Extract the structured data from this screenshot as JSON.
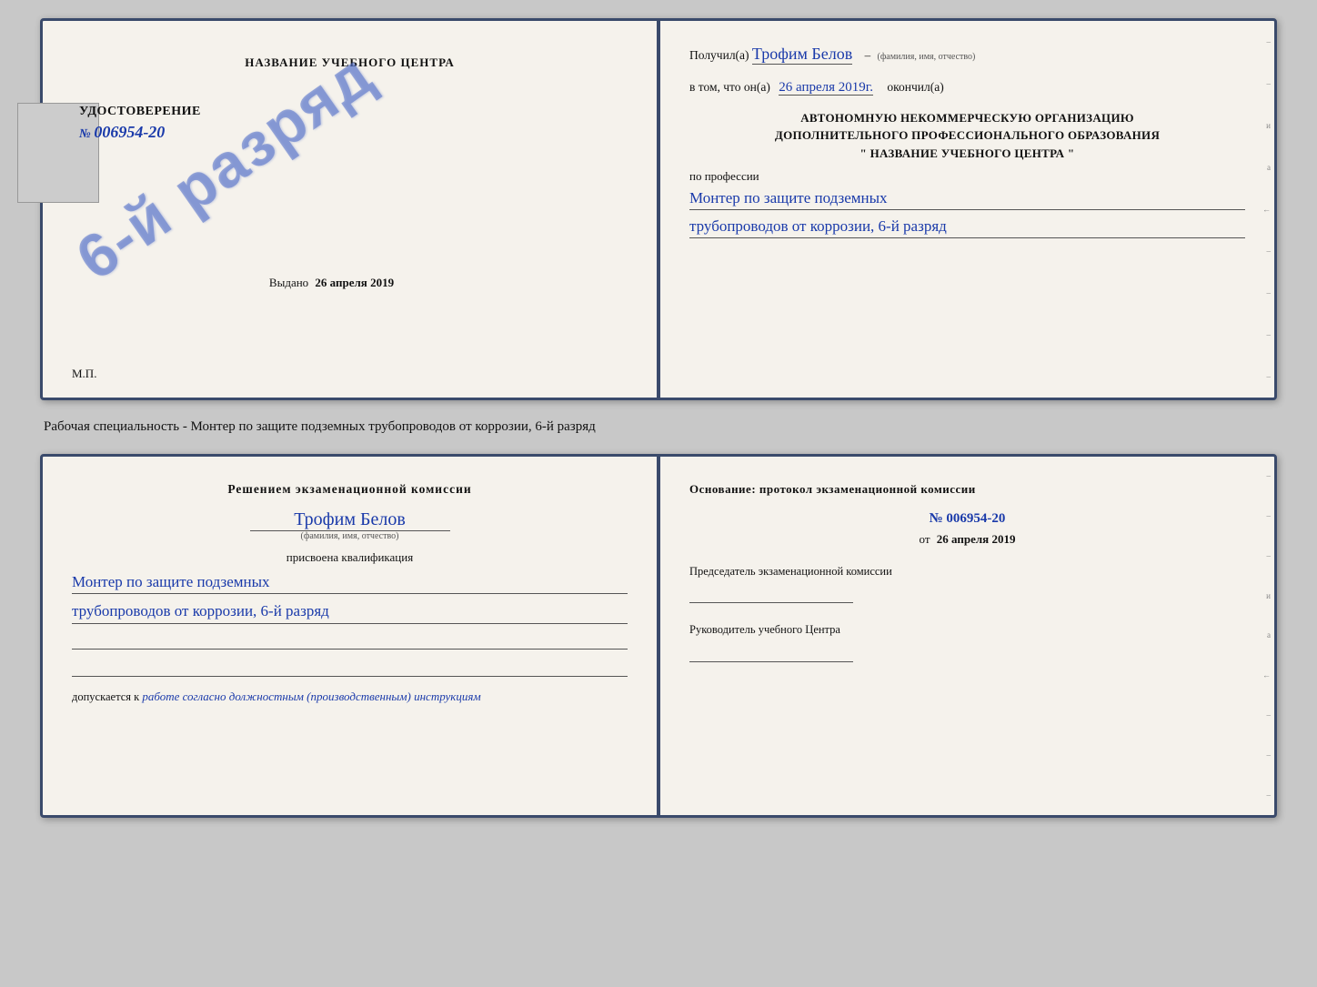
{
  "doc1": {
    "left": {
      "center_title": "НАЗВАНИЕ УЧЕБНОГО ЦЕНТРА",
      "cert_label": "УДОСТОВЕРЕНИЕ",
      "cert_number_prefix": "№",
      "cert_number": "006954-20",
      "issued_prefix": "Выдано",
      "issued_date": "26 апреля 2019",
      "mp_label": "М.П.",
      "stamp_text": "6-й разряд"
    },
    "right": {
      "received_prefix": "Получил(а)",
      "received_name": "Трофим Белов",
      "name_caption": "(фамилия, имя, отчество)",
      "completed_prefix": "в том, что он(а)",
      "completed_date": "26 апреля 2019г.",
      "completed_suffix": "окончил(а)",
      "org_line1": "АВТОНОМНУЮ НЕКОММЕРЧЕСКУЮ ОРГАНИЗАЦИЮ",
      "org_line2": "ДОПОЛНИТЕЛЬНОГО ПРОФЕССИОНАЛЬНОГО ОБРАЗОВАНИЯ",
      "org_quote_open": "\"",
      "org_name": "НАЗВАНИЕ УЧЕБНОГО ЦЕНТРА",
      "org_quote_close": "\"",
      "profession_prefix": "по профессии",
      "profession_line1": "Монтер по защите подземных",
      "profession_line2": "трубопроводов от коррозии, 6-й разряд"
    }
  },
  "specialty_text": "Рабочая специальность - Монтер по защите подземных трубопроводов от коррозии, 6-й разряд",
  "doc2": {
    "left": {
      "decision_title": "Решением экзаменационной комиссии",
      "person_name": "Трофим Белов",
      "name_caption": "(фамилия, имя, отчество)",
      "qualification_label": "присвоена квалификация",
      "qualification_line1": "Монтер по защите подземных",
      "qualification_line2": "трубопроводов от коррозии, 6-й разряд",
      "allowed_prefix": "допускается к",
      "allowed_value": "работе согласно должностным (производственным) инструкциям"
    },
    "right": {
      "basis_title": "Основание: протокол экзаменационной комиссии",
      "basis_number": "№ 006954-20",
      "basis_date_prefix": "от",
      "basis_date": "26 апреля 2019",
      "chairman_label": "Председатель экзаменационной комиссии",
      "director_label": "Руководитель учебного Центра"
    }
  }
}
